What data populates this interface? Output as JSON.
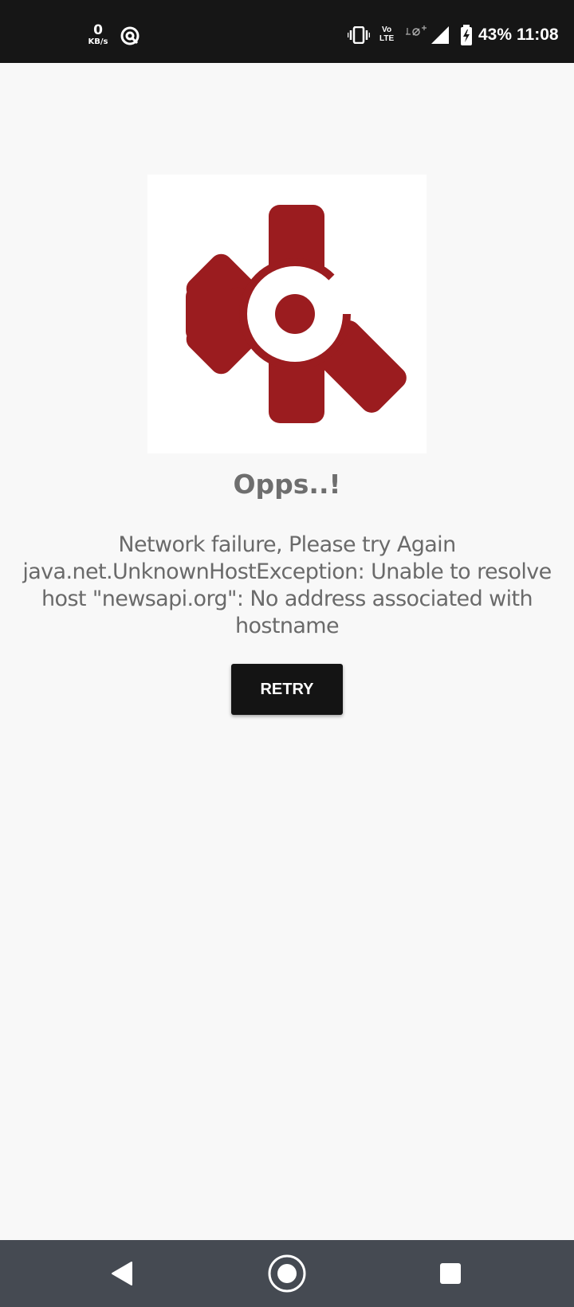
{
  "status_bar": {
    "net_speed_value": "0",
    "net_speed_unit": "KB/s",
    "battery_percent": "43%",
    "time": "11:08",
    "icons": [
      "data-saver-icon",
      "vibrate-icon",
      "volte-icon",
      "wifi-calling-icon",
      "signal-icon",
      "battery-charging-icon"
    ],
    "volte_label_top": "Vo",
    "volte_label_bottom": "LTE"
  },
  "error": {
    "logo": "app-logo-gear",
    "logo_color": "#9b1c1f",
    "title": "Opps..!",
    "message": "Network failure, Please try Again java.net.UnknownHostException: Unable to resolve host \"newsapi.org\": No address associated with hostname",
    "retry_label": "RETRY"
  },
  "nav_bar": {
    "buttons": [
      "back-icon",
      "home-icon",
      "recents-icon"
    ]
  }
}
